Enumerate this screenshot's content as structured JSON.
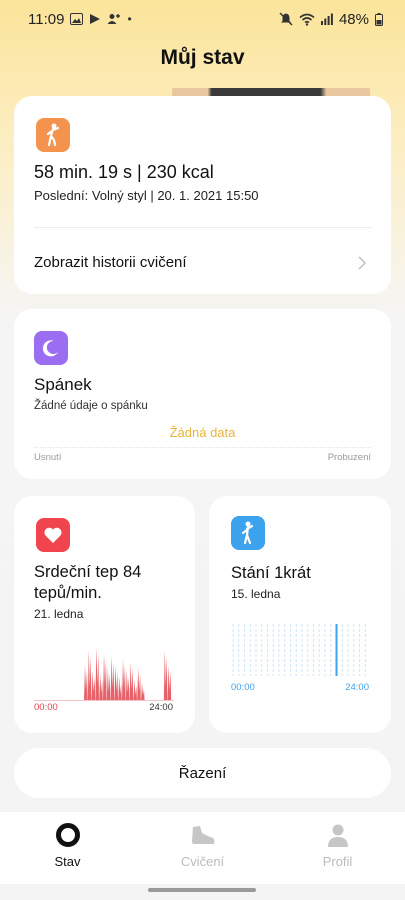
{
  "status_bar": {
    "time": "11:09",
    "left_icons": [
      "gallery-icon",
      "play-store-icon",
      "add-contact-icon",
      "dot-icon"
    ],
    "right_icons": [
      "mute-icon",
      "wifi-icon",
      "signal-icon",
      "battery-icon"
    ],
    "battery": "48%"
  },
  "header": {
    "title": "Můj stav"
  },
  "exercise_card": {
    "icon": "walking-person-icon",
    "icon_color": "#f3934e",
    "value": "58 min. 19 s | 230 kcal",
    "last": "Poslední: Volný styl | 20. 1. 2021 15:50",
    "history_label": "Zobrazit historii cvičení"
  },
  "sleep_card": {
    "icon": "moon-icon",
    "icon_color": "#9b6df0",
    "title": "Spánek",
    "subtitle": "Žádné údaje o spánku",
    "no_data": "Žádná data",
    "left_label": "Usnutí",
    "right_label": "Probuzení"
  },
  "heart_card": {
    "icon": "heart-icon",
    "icon_color": "#f0454f",
    "title": "Srdeční tep 84 tepů/min.",
    "date": "21. ledna",
    "time_start": "00:00",
    "time_end": "24:00",
    "bar_heights": [
      0.6,
      0.85,
      0.5,
      0.9,
      0.45,
      0.8,
      0.55,
      0.75,
      0.6,
      0.4,
      0.7,
      0.5,
      0.65,
      0.35,
      0.55,
      0.3,
      0.0,
      0.0,
      0.0,
      0.0,
      0.0,
      0.85,
      0.6
    ]
  },
  "stand_card": {
    "icon": "standing-person-icon",
    "icon_color": "#3ea3ee",
    "title": "Stání 1krát",
    "date": "15. ledna",
    "time_start": "00:00",
    "time_end": "24:00",
    "active_hour": 18,
    "hours": 24
  },
  "sort_label": "Řazení",
  "nav": {
    "items": [
      {
        "label": "Stav",
        "icon": "status-ring-icon",
        "active": true
      },
      {
        "label": "Cvičení",
        "icon": "shoe-icon",
        "active": false
      },
      {
        "label": "Profil",
        "icon": "profile-icon",
        "active": false
      }
    ]
  }
}
